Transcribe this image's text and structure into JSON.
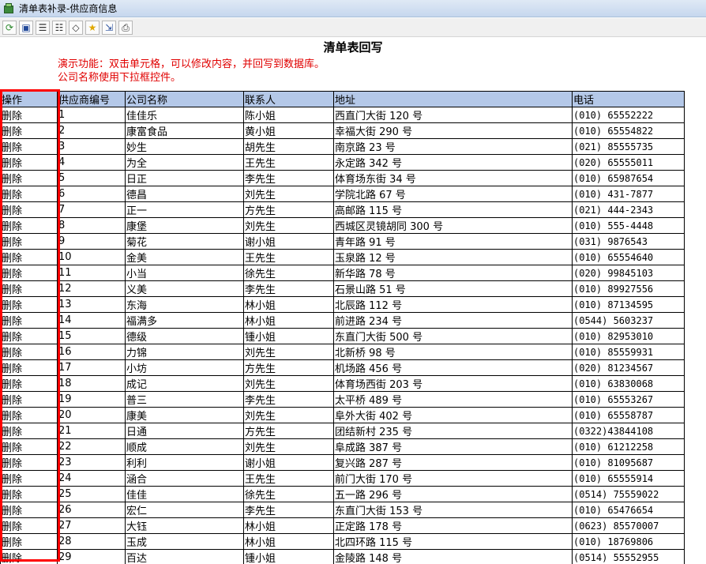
{
  "window": {
    "title": "清单表补录-供应商信息"
  },
  "page": {
    "heading": "清单表回写",
    "description_line1": "演示功能：双击单元格，可以修改内容，并回写到数据库。",
    "description_line2": "公司名称使用下拉框控件。"
  },
  "toolbar": {
    "buttons": [
      "refresh-icon",
      "save-icon",
      "insert-row-icon",
      "delete-row-icon",
      "eraser-icon",
      "star-icon",
      "export-icon",
      "print-icon"
    ]
  },
  "table": {
    "headers": {
      "op": "操作",
      "id": "供应商编号",
      "company": "公司名称",
      "contact": "联系人",
      "address": "地址",
      "phone": "电话"
    },
    "action_label": "删除",
    "rows": [
      {
        "id": "1",
        "company": "佳佳乐",
        "contact": "陈小姐",
        "address": "西直门大街 120 号",
        "phone": "(010) 65552222"
      },
      {
        "id": "2",
        "company": "康富食品",
        "contact": "黄小姐",
        "address": "幸福大街 290 号",
        "phone": "(010) 65554822"
      },
      {
        "id": "3",
        "company": "妙生",
        "contact": "胡先生",
        "address": "南京路 23 号",
        "phone": "(021) 85555735"
      },
      {
        "id": "4",
        "company": "为全",
        "contact": "王先生",
        "address": "永定路 342 号",
        "phone": "(020) 65555011"
      },
      {
        "id": "5",
        "company": "日正",
        "contact": "李先生",
        "address": "体育场东街 34 号",
        "phone": "(010) 65987654"
      },
      {
        "id": "6",
        "company": "德昌",
        "contact": "刘先生",
        "address": "学院北路 67 号",
        "phone": "(010) 431-7877"
      },
      {
        "id": "7",
        "company": "正一",
        "contact": "方先生",
        "address": "高邮路 115 号",
        "phone": "(021) 444-2343"
      },
      {
        "id": "8",
        "company": "康堡",
        "contact": "刘先生",
        "address": "西城区灵镜胡同 300 号",
        "phone": "(010) 555-4448"
      },
      {
        "id": "9",
        "company": "菊花",
        "contact": "谢小姐",
        "address": "青年路 91 号",
        "phone": "(031) 9876543"
      },
      {
        "id": "10",
        "company": "金美",
        "contact": "王先生",
        "address": "玉泉路 12 号",
        "phone": "(010) 65554640"
      },
      {
        "id": "11",
        "company": "小当",
        "contact": "徐先生",
        "address": "新华路 78 号",
        "phone": "(020) 99845103"
      },
      {
        "id": "12",
        "company": "义美",
        "contact": "李先生",
        "address": "石景山路 51 号",
        "phone": "(010) 89927556"
      },
      {
        "id": "13",
        "company": "东海",
        "contact": "林小姐",
        "address": "北辰路 112 号",
        "phone": "(010) 87134595"
      },
      {
        "id": "14",
        "company": "福满多",
        "contact": "林小姐",
        "address": "前进路 234 号",
        "phone": "(0544) 5603237"
      },
      {
        "id": "15",
        "company": "德级",
        "contact": "锺小姐",
        "address": "东直门大街 500 号",
        "phone": "(010) 82953010"
      },
      {
        "id": "16",
        "company": "力锦",
        "contact": "刘先生",
        "address": "北新桥 98 号",
        "phone": "(010) 85559931"
      },
      {
        "id": "17",
        "company": "小坊",
        "contact": "方先生",
        "address": "机场路 456 号",
        "phone": "(020) 81234567"
      },
      {
        "id": "18",
        "company": "成记",
        "contact": "刘先生",
        "address": "体育场西街 203 号",
        "phone": "(010) 63830068"
      },
      {
        "id": "19",
        "company": "普三",
        "contact": "李先生",
        "address": "太平桥 489 号",
        "phone": "(010) 65553267"
      },
      {
        "id": "20",
        "company": "康美",
        "contact": "刘先生",
        "address": "阜外大街 402 号",
        "phone": "(010) 65558787"
      },
      {
        "id": "21",
        "company": "日通",
        "contact": "方先生",
        "address": "团结新村 235 号",
        "phone": "(0322)43844108"
      },
      {
        "id": "22",
        "company": "顺成",
        "contact": "刘先生",
        "address": "阜成路 387 号",
        "phone": "(010) 61212258"
      },
      {
        "id": "23",
        "company": "利利",
        "contact": "谢小姐",
        "address": "复兴路 287 号",
        "phone": "(010) 81095687"
      },
      {
        "id": "24",
        "company": "涵合",
        "contact": "王先生",
        "address": "前门大街 170 号",
        "phone": "(010) 65555914"
      },
      {
        "id": "25",
        "company": "佳佳",
        "contact": "徐先生",
        "address": "五一路 296 号",
        "phone": "(0514) 75559022"
      },
      {
        "id": "26",
        "company": "宏仁",
        "contact": "李先生",
        "address": "东直门大街 153 号",
        "phone": "(010) 65476654"
      },
      {
        "id": "27",
        "company": "大钰",
        "contact": "林小姐",
        "address": "正定路 178 号",
        "phone": "(0623) 85570007"
      },
      {
        "id": "28",
        "company": "玉成",
        "contact": "林小姐",
        "address": "北四环路 115 号",
        "phone": "(010) 18769806"
      },
      {
        "id": "29",
        "company": "百达",
        "contact": "锺小姐",
        "address": "金陵路 148 号",
        "phone": "(0514) 55552955"
      }
    ]
  },
  "colors": {
    "header_bg": "#b4c8e8",
    "highlight": "#ff0000",
    "description": "#e00000"
  }
}
